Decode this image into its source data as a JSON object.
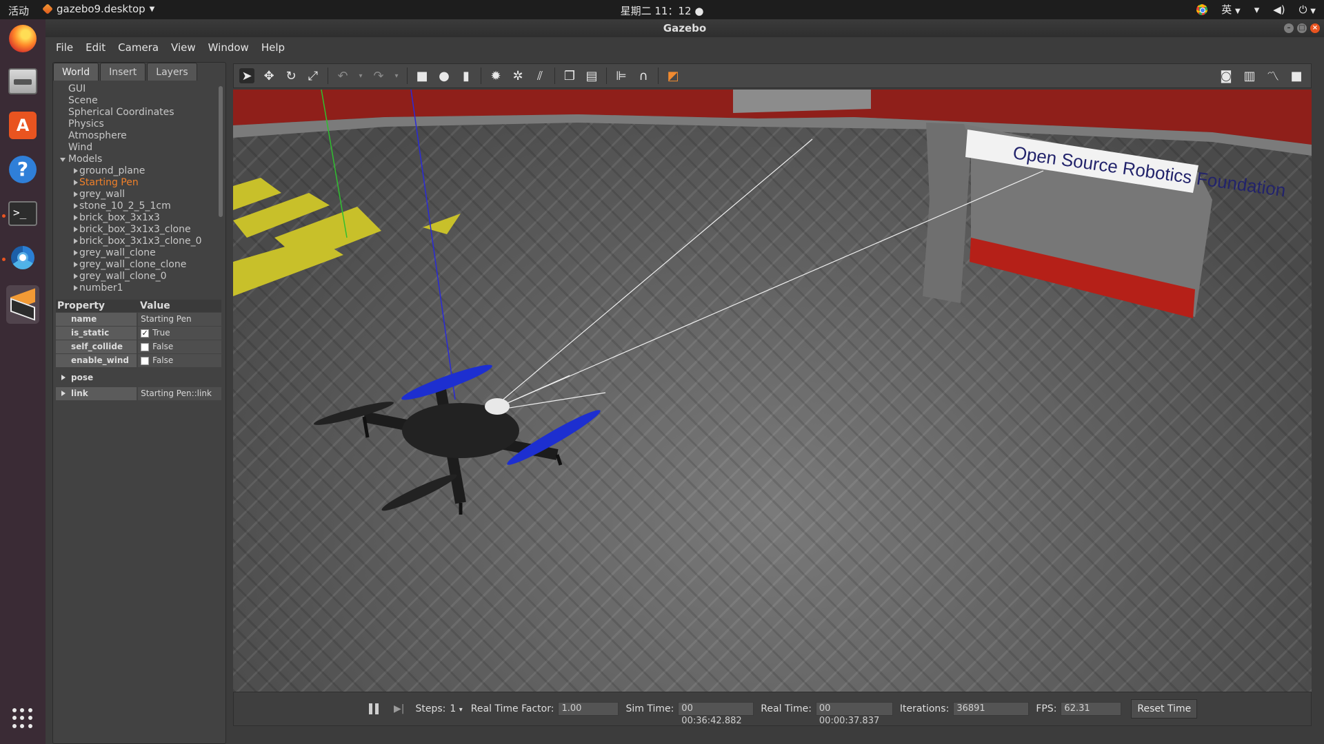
{
  "topbar": {
    "activities": "活动",
    "app_name": "gazebo9.desktop",
    "clock": "星期二 11：12",
    "input_method": "英"
  },
  "dock": {
    "icons": [
      "firefox-icon",
      "files-icon",
      "software-store-icon",
      "help-icon",
      "terminal-icon",
      "chromium-icon",
      "gazebo-icon",
      "show-apps-icon"
    ]
  },
  "window": {
    "title": "Gazebo",
    "menu": [
      "File",
      "Edit",
      "Camera",
      "View",
      "Window",
      "Help"
    ]
  },
  "left_panel": {
    "tabs": [
      "World",
      "Insert",
      "Layers"
    ],
    "active_tab": "World",
    "tree": {
      "top_items": [
        "GUI",
        "Scene",
        "Spherical Coordinates",
        "Physics",
        "Atmosphere",
        "Wind"
      ],
      "models_label": "Models",
      "models": [
        "ground_plane",
        "Starting Pen",
        "grey_wall",
        "stone_10_2_5_1cm",
        "brick_box_3x1x3",
        "brick_box_3x1x3_clone",
        "brick_box_3x1x3_clone_0",
        "grey_wall_clone",
        "grey_wall_clone_clone",
        "grey_wall_clone_0",
        "number1"
      ],
      "selected_model": "Starting Pen"
    },
    "properties": {
      "header_property": "Property",
      "header_value": "Value",
      "rows": [
        {
          "key": "name",
          "value": "Starting Pen",
          "checkbox": null
        },
        {
          "key": "is_static",
          "value": "True",
          "checkbox": true
        },
        {
          "key": "self_collide",
          "value": "False",
          "checkbox": false
        },
        {
          "key": "enable_wind",
          "value": "False",
          "checkbox": false
        }
      ],
      "groups": [
        {
          "key": "pose",
          "value": ""
        },
        {
          "key": "link",
          "value": "Starting Pen::link"
        }
      ]
    }
  },
  "toolbar": {
    "tools": [
      "select-arrow-icon",
      "translate-icon",
      "rotate-icon",
      "scale-icon",
      "undo-icon",
      "redo-icon",
      "box-icon",
      "sphere-icon",
      "cylinder-icon",
      "point-light-icon",
      "spot-light-icon",
      "directional-light-icon",
      "copy-icon",
      "paste-icon",
      "align-icon",
      "snap-icon",
      "view-angle-icon"
    ],
    "right_tools": [
      "screenshot-icon",
      "log-icon",
      "plot-icon",
      "record-video-icon"
    ]
  },
  "viewport": {
    "sign_text": "Open Source Robotics Foundation",
    "colors": {
      "wall_red": "#8f1f1a",
      "floor": "#5e5e5e",
      "propeller_blue": "#1d2fd0",
      "floor_marking_yellow": "#c8c02a"
    }
  },
  "bottom_bar": {
    "steps_label": "Steps:",
    "steps_value": "1",
    "rtf_label": "Real Time Factor:",
    "rtf_value": "1.00",
    "sim_time_label": "Sim Time:",
    "sim_time_value": "00 00:36:42.882",
    "real_time_label": "Real Time:",
    "real_time_value": "00 00:00:37.837",
    "iterations_label": "Iterations:",
    "iterations_value": "36891",
    "fps_label": "FPS:",
    "fps_value": "62.31",
    "reset_label": "Reset Time"
  }
}
